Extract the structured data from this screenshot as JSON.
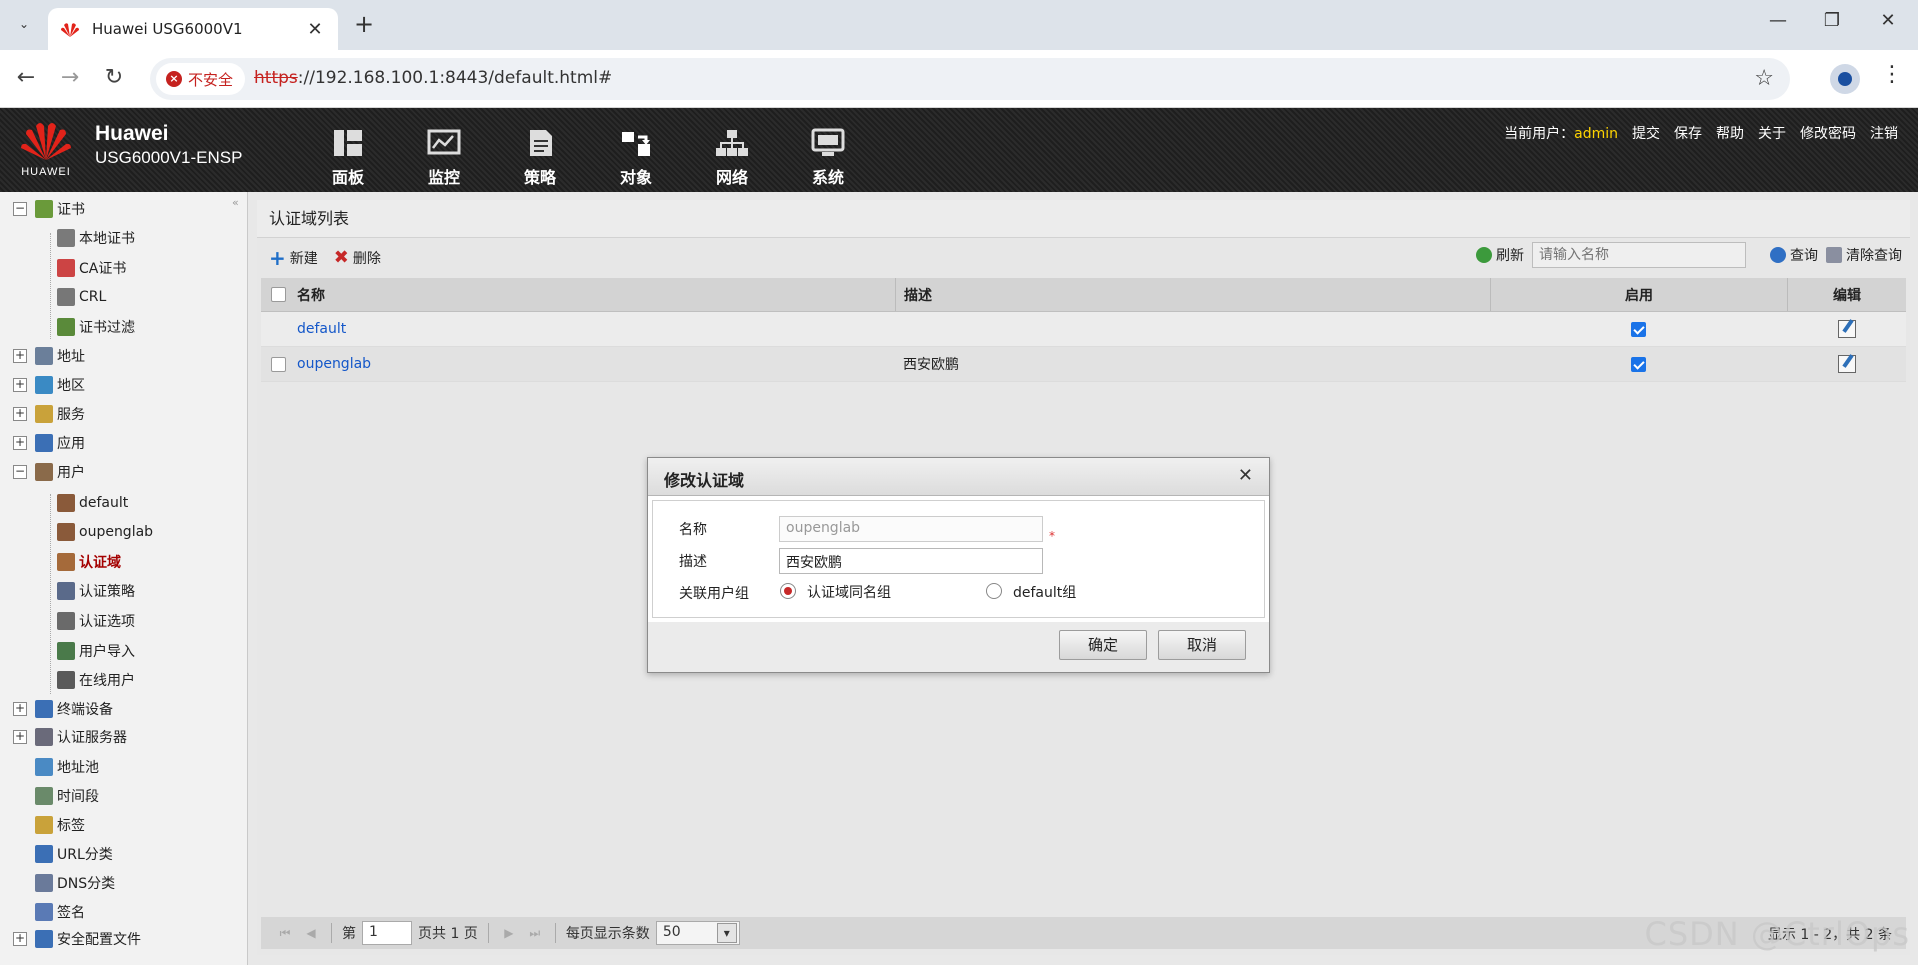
{
  "browser": {
    "tab_title": "Huawei USG6000V1",
    "security_label": "不安全",
    "url_scheme": "https",
    "url_rest": "://192.168.100.1:8443/default.html#"
  },
  "header": {
    "brand_word": "HUAWEI",
    "brand_line1": "Huawei",
    "brand_line2": "USG6000V1-ENSP",
    "nav": [
      {
        "label": "面板",
        "icon": "dashboard-icon"
      },
      {
        "label": "监控",
        "icon": "monitor-icon"
      },
      {
        "label": "策略",
        "icon": "policy-icon"
      },
      {
        "label": "对象",
        "icon": "object-icon"
      },
      {
        "label": "网络",
        "icon": "network-icon"
      },
      {
        "label": "系统",
        "icon": "system-icon"
      }
    ],
    "current_user_label": "当前用户：",
    "username": "admin",
    "links": [
      "提交",
      "保存",
      "帮助",
      "关于",
      "修改密码",
      "注销"
    ]
  },
  "sidebar": {
    "items": [
      {
        "label": "证书",
        "toggle": "−",
        "level": 0
      },
      {
        "label": "本地证书",
        "level": 1
      },
      {
        "label": "CA证书",
        "level": 1
      },
      {
        "label": "CRL",
        "level": 1
      },
      {
        "label": "证书过滤",
        "level": 1
      },
      {
        "label": "地址",
        "toggle": "+",
        "level": 0
      },
      {
        "label": "地区",
        "toggle": "+",
        "level": 0
      },
      {
        "label": "服务",
        "toggle": "+",
        "level": 0
      },
      {
        "label": "应用",
        "toggle": "+",
        "level": 0
      },
      {
        "label": "用户",
        "toggle": "−",
        "level": 0
      },
      {
        "label": "default",
        "level": 1
      },
      {
        "label": "oupenglab",
        "level": 1
      },
      {
        "label": "认证域",
        "level": 1,
        "active": true
      },
      {
        "label": "认证策略",
        "level": 1
      },
      {
        "label": "认证选项",
        "level": 1
      },
      {
        "label": "用户导入",
        "level": 1
      },
      {
        "label": "在线用户",
        "level": 1
      },
      {
        "label": "终端设备",
        "toggle": "+",
        "level": 0
      },
      {
        "label": "认证服务器",
        "toggle": "+",
        "level": 0
      },
      {
        "label": "地址池",
        "level": 0
      },
      {
        "label": "时间段",
        "level": 0
      },
      {
        "label": "标签",
        "level": 0
      },
      {
        "label": "URL分类",
        "level": 0
      },
      {
        "label": "DNS分类",
        "level": 0
      },
      {
        "label": "签名",
        "level": 0
      },
      {
        "label": "安全配置文件",
        "toggle": "+",
        "level": 0
      }
    ]
  },
  "content": {
    "title": "认证域列表",
    "new_label": "新建",
    "delete_label": "删除",
    "refresh_label": "刷新",
    "search_placeholder": "请输入名称",
    "query_label": "查询",
    "clear_query_label": "清除查询",
    "columns": {
      "name": "名称",
      "desc": "描述",
      "enabled": "启用",
      "edit": "编辑"
    },
    "rows": [
      {
        "name": "default",
        "desc": "",
        "enabled": true
      },
      {
        "name": "oupenglab",
        "desc": "西安欧鹏",
        "enabled": true
      }
    ],
    "pager": {
      "page_prefix": "第",
      "page": "1",
      "page_suffix": "页共 1 页",
      "per_page_label": "每页显示条数",
      "per_page": "50",
      "summary": "显示 1 - 2，共 2 条"
    }
  },
  "modal": {
    "title": "修改认证域",
    "name_label": "名称",
    "name_value": "oupenglab",
    "desc_label": "描述",
    "desc_value": "西安欧鹏",
    "group_label": "关联用户组",
    "radio1": "认证域同名组",
    "radio2": "default组",
    "ok": "确定",
    "cancel": "取消"
  },
  "watermark": "CSDN @CtrlOps"
}
